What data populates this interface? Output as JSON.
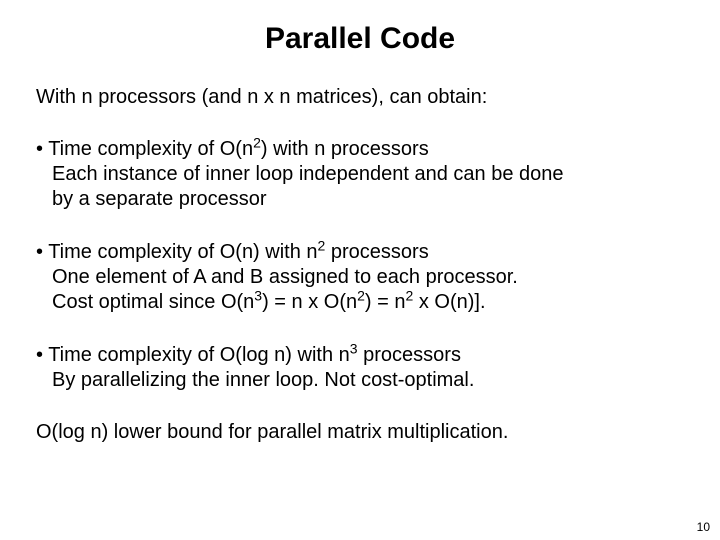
{
  "title": "Parallel Code",
  "lead": "With n processors (and n x n matrices), can obtain:",
  "bullets": [
    {
      "first_pre": "• Time complexity of O(n",
      "first_sup": "2",
      "first_post": ") with n processors",
      "cont1": "Each instance of inner loop independent and can be done",
      "cont2": "by a separate processor"
    },
    {
      "first_pre": "• Time complexity of O(n) with n",
      "first_sup": "2",
      "first_post": " processors",
      "cont1": "One element of A and B assigned to each processor.",
      "cont2_pre": "Cost optimal since O(n",
      "cont2_sup1": "3",
      "cont2_mid1": ") = n x O(n",
      "cont2_sup2": "2",
      "cont2_mid2": ") = n",
      "cont2_sup3": "2",
      "cont2_post": " x O(n)]."
    },
    {
      "first_pre": "• Time complexity of O(log n) with n",
      "first_sup": "3",
      "first_post": " processors",
      "cont1": "By parallelizing the inner loop. Not cost-optimal."
    }
  ],
  "closing": "O(log n) lower bound for parallel matrix multiplication.",
  "page_number": "10"
}
